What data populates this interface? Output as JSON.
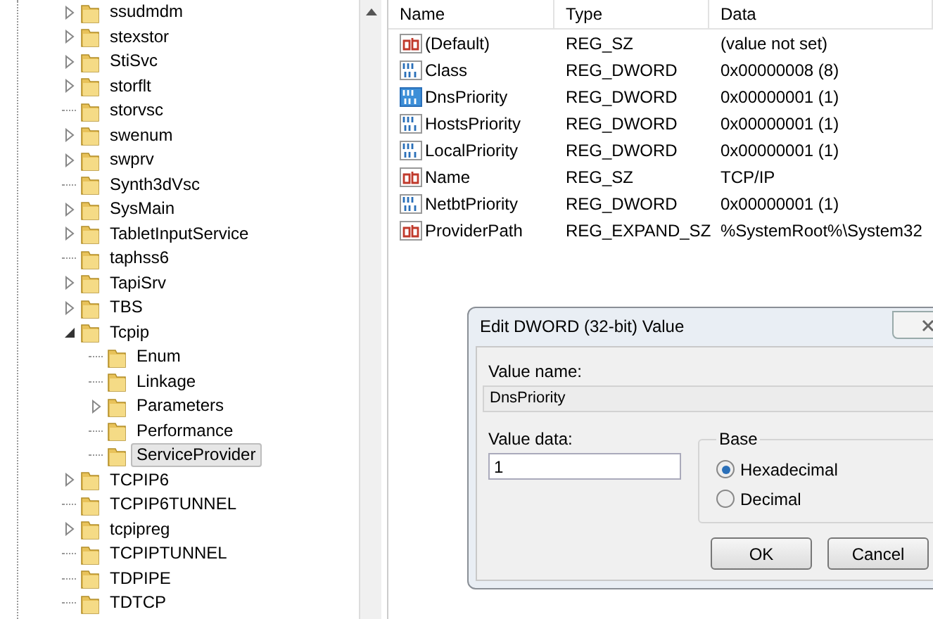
{
  "tree": {
    "items": [
      {
        "label": "ssudmdm",
        "kind": "collapsed",
        "selected": false
      },
      {
        "label": "stexstor",
        "kind": "collapsed",
        "selected": false
      },
      {
        "label": "StiSvc",
        "kind": "collapsed",
        "selected": false
      },
      {
        "label": "storflt",
        "kind": "collapsed",
        "selected": false
      },
      {
        "label": "storvsc",
        "kind": "leaf",
        "selected": false
      },
      {
        "label": "swenum",
        "kind": "collapsed",
        "selected": false
      },
      {
        "label": "swprv",
        "kind": "collapsed",
        "selected": false
      },
      {
        "label": "Synth3dVsc",
        "kind": "leaf",
        "selected": false
      },
      {
        "label": "SysMain",
        "kind": "collapsed",
        "selected": false
      },
      {
        "label": "TabletInputService",
        "kind": "collapsed",
        "selected": false
      },
      {
        "label": "taphss6",
        "kind": "leaf",
        "selected": false
      },
      {
        "label": "TapiSrv",
        "kind": "collapsed",
        "selected": false
      },
      {
        "label": "TBS",
        "kind": "collapsed",
        "selected": false
      },
      {
        "label": "Tcpip",
        "kind": "expanded",
        "selected": false,
        "children": [
          {
            "label": "Enum",
            "kind": "leaf",
            "selected": false
          },
          {
            "label": "Linkage",
            "kind": "leaf",
            "selected": false
          },
          {
            "label": "Parameters",
            "kind": "collapsed",
            "selected": false
          },
          {
            "label": "Performance",
            "kind": "leaf",
            "selected": false
          },
          {
            "label": "ServiceProvider",
            "kind": "leaf",
            "selected": true
          }
        ]
      },
      {
        "label": "TCPIP6",
        "kind": "collapsed",
        "selected": false
      },
      {
        "label": "TCPIP6TUNNEL",
        "kind": "leaf",
        "selected": false
      },
      {
        "label": "tcpipreg",
        "kind": "collapsed",
        "selected": false
      },
      {
        "label": "TCPIPTUNNEL",
        "kind": "leaf",
        "selected": false
      },
      {
        "label": "TDPIPE",
        "kind": "leaf",
        "selected": false
      },
      {
        "label": "TDTCP",
        "kind": "leaf",
        "selected": false
      }
    ]
  },
  "values": {
    "columns": [
      "Name",
      "Type",
      "Data"
    ],
    "rows": [
      {
        "kind": "string",
        "name": "(Default)",
        "type": "REG_SZ",
        "data": "(value not set)",
        "selected": false
      },
      {
        "kind": "dword",
        "name": "Class",
        "type": "REG_DWORD",
        "data": "0x00000008 (8)",
        "selected": false
      },
      {
        "kind": "dword",
        "name": "DnsPriority",
        "type": "REG_DWORD",
        "data": "0x00000001 (1)",
        "selected": true
      },
      {
        "kind": "dword",
        "name": "HostsPriority",
        "type": "REG_DWORD",
        "data": "0x00000001 (1)",
        "selected": false
      },
      {
        "kind": "dword",
        "name": "LocalPriority",
        "type": "REG_DWORD",
        "data": "0x00000001 (1)",
        "selected": false
      },
      {
        "kind": "string",
        "name": "Name",
        "type": "REG_SZ",
        "data": "TCP/IP",
        "selected": false
      },
      {
        "kind": "dword",
        "name": "NetbtPriority",
        "type": "REG_DWORD",
        "data": "0x00000001 (1)",
        "selected": false
      },
      {
        "kind": "string",
        "name": "ProviderPath",
        "type": "REG_EXPAND_SZ",
        "data": "%SystemRoot%\\System32",
        "selected": false
      }
    ]
  },
  "dialog": {
    "title": "Edit DWORD (32-bit) Value",
    "value_name_label": "Value name:",
    "value_name": "DnsPriority",
    "value_data_label": "Value data:",
    "value_data": "1",
    "base": {
      "label": "Base",
      "options": [
        {
          "label": "Hexadecimal",
          "selected": true
        },
        {
          "label": "Decimal",
          "selected": false
        }
      ]
    },
    "buttons": [
      "OK",
      "Cancel"
    ]
  }
}
